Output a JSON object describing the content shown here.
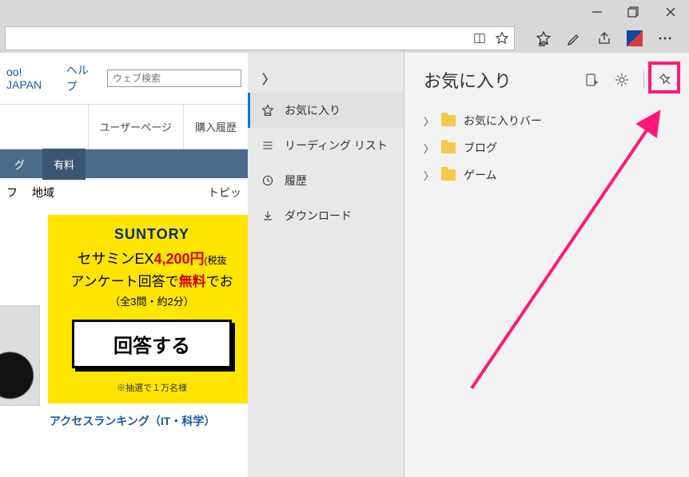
{
  "titlebar": {
    "minimize": "—",
    "maximize": "❐",
    "close": "✕"
  },
  "toolbar": {
    "reading_icon": "reading-view",
    "star_icon": "star",
    "fav_icon": "favorites-star",
    "note_icon": "web-note",
    "share_icon": "share",
    "more_icon": "more"
  },
  "page": {
    "brand": "oo! JAPAN",
    "help": "ヘルプ",
    "search_placeholder": "ウェブ検索",
    "link_user": "ユーザーページ",
    "link_history": "購入履歴",
    "nav_g": "グ",
    "nav_paid": "有料",
    "sub_f": "フ",
    "sub_region": "地域",
    "sub_topic": "トピッ"
  },
  "ad": {
    "brand": "SUNTORY",
    "product": "セサミンEX",
    "price": "4,200円",
    "tax": "(税抜",
    "survey": "アンケート回答で",
    "free": "無料",
    "deo": "でお",
    "note": "（全3問・約2分）",
    "button": "回答する",
    "footnote": "※抽選で１万名様",
    "caption": "アクセスランキング（IT・科学）"
  },
  "hub": {
    "items": [
      {
        "label": "お気に入り",
        "icon": "star"
      },
      {
        "label": "リーディング リスト",
        "icon": "list"
      },
      {
        "label": "履歴",
        "icon": "history"
      },
      {
        "label": "ダウンロード",
        "icon": "download"
      }
    ]
  },
  "favorites": {
    "title": "お気に入り",
    "folders": [
      {
        "name": "お気に入りバー"
      },
      {
        "name": "ブログ"
      },
      {
        "name": "ゲーム"
      }
    ]
  }
}
